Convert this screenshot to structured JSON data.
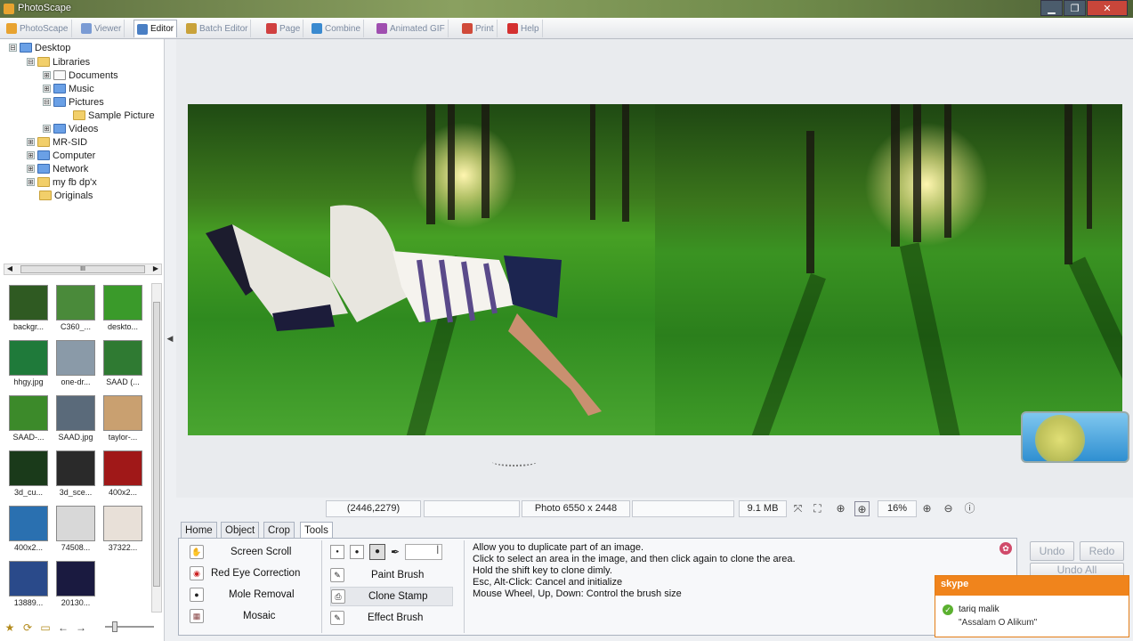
{
  "window": {
    "title": "PhotoScape",
    "min": "▁",
    "max": "❐",
    "close": "✕"
  },
  "tabs": [
    {
      "label": "PhotoScape",
      "color": "#e8a330"
    },
    {
      "label": "Viewer",
      "color": "#7a9bd4"
    },
    {
      "label": "Editor",
      "color": "#4a7fc4"
    },
    {
      "label": "Batch Editor",
      "color": "#c9a23a"
    },
    {
      "label": "Page",
      "color": "#d04040"
    },
    {
      "label": "Combine",
      "color": "#3a8ad0"
    },
    {
      "label": "Animated GIF",
      "color": "#a04fb0"
    },
    {
      "label": "Print",
      "color": "#d04a3a"
    },
    {
      "label": "Help",
      "color": "#d43030"
    }
  ],
  "tree": [
    {
      "label": "Desktop",
      "exp": "⊟"
    },
    {
      "label": "Libraries",
      "exp": "⊟"
    },
    {
      "label": "Documents",
      "exp": "⊞"
    },
    {
      "label": "Music",
      "exp": "⊞"
    },
    {
      "label": "Pictures",
      "exp": "⊟"
    },
    {
      "label": "Sample Picture",
      "exp": ""
    },
    {
      "label": "Videos",
      "exp": "⊞"
    },
    {
      "label": "MR-SID",
      "exp": "⊞"
    },
    {
      "label": "Computer",
      "exp": "⊞"
    },
    {
      "label": "Network",
      "exp": "⊞"
    },
    {
      "label": "my fb dp'x",
      "exp": "⊞"
    },
    {
      "label": "Originals",
      "exp": ""
    }
  ],
  "hscroll_label": "III",
  "thumbnails": [
    {
      "label": "backgr...",
      "color": "#2f5a22"
    },
    {
      "label": "C360_...",
      "color": "#4a8a3a"
    },
    {
      "label": "deskto...",
      "color": "#3a9a2a"
    },
    {
      "label": "hhgy.jpg",
      "color": "#1f7a3a"
    },
    {
      "label": "one-dr...",
      "color": "#8a9aa8"
    },
    {
      "label": "SAAD (...",
      "color": "#2f7a32"
    },
    {
      "label": "SAAD-...",
      "color": "#3c8a2a"
    },
    {
      "label": "SAAD.jpg",
      "color": "#5a6a7a"
    },
    {
      "label": "taylor-...",
      "color": "#c9a070"
    },
    {
      "label": "3d_cu...",
      "color": "#1a3a1a"
    },
    {
      "label": "3d_sce...",
      "color": "#2a2a2a"
    },
    {
      "label": "400x2...",
      "color": "#a01818"
    },
    {
      "label": "400x2...",
      "color": "#2a70b0"
    },
    {
      "label": "74508...",
      "color": "#d8d8d8"
    },
    {
      "label": "37322...",
      "color": "#e8e0d8"
    },
    {
      "label": "13889...",
      "color": "#2a4a8a"
    },
    {
      "label": "20130...",
      "color": "#1a1a40"
    }
  ],
  "bottom_icons": [
    "star-icon",
    "refresh-icon",
    "folder-icon",
    "back-icon",
    "forward-icon"
  ],
  "status": {
    "coords": "(2446,2279)",
    "empty1": "",
    "photo": "Photo 6550 x 2448",
    "empty2": "",
    "size": "9.1 MB",
    "zoom": "16%"
  },
  "tool_tabs": [
    "Home",
    "Object",
    "Crop",
    "Tools"
  ],
  "tools_left": [
    {
      "label": "Screen Scroll",
      "icon": "✋"
    },
    {
      "label": "Red Eye Correction",
      "icon": "◉"
    },
    {
      "label": "Mole Removal",
      "icon": "●"
    },
    {
      "label": "Mosaic",
      "icon": "▦"
    }
  ],
  "tools_right": [
    {
      "label": "Paint Brush",
      "icon": "✎"
    },
    {
      "label": "Clone Stamp",
      "icon": "⎙"
    },
    {
      "label": "Effect Brush",
      "icon": "✎"
    }
  ],
  "description": [
    "Allow you to duplicate part of an image.",
    "Click to select an area in the image, and then click again to clone the area.",
    "Hold the shift key to clone dimly.",
    "Esc, Alt-Click: Cancel and initialize",
    "Mouse Wheel, Up, Down: Control the brush size"
  ],
  "buttons": {
    "undo": "Undo",
    "redo": "Redo",
    "undo_all": "Undo All"
  },
  "skype": {
    "brand": "skype",
    "name": "tariq malik",
    "message": "\"Assalam O Alikum\""
  }
}
